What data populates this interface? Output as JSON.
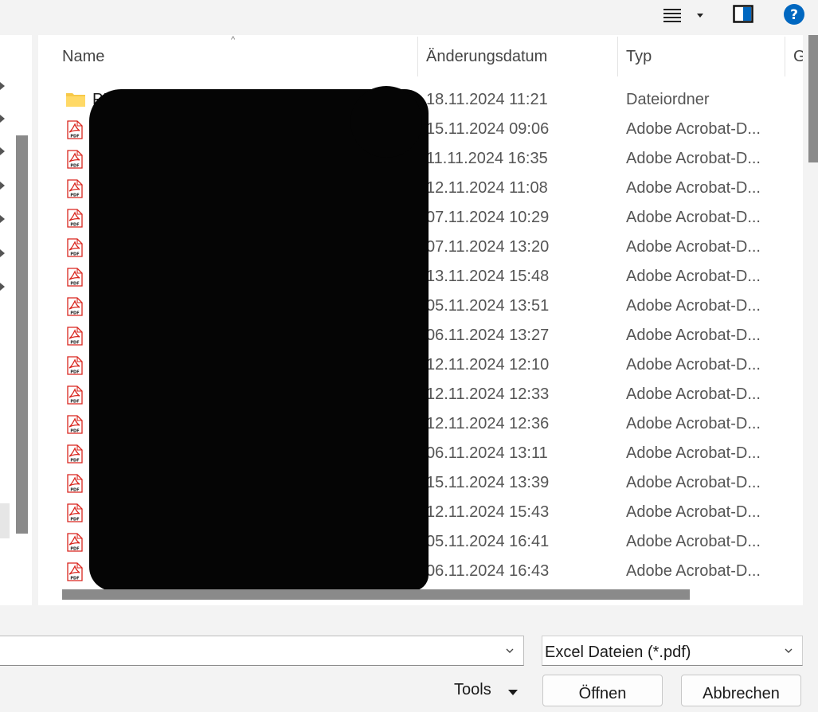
{
  "toolbar": {
    "view_icon": "list-view-icon",
    "dropdown_icon": "chevron-down-icon",
    "pane_icon": "preview-pane-icon",
    "help_icon": "help-icon",
    "help_label": "?",
    "help_color": "#0067c0"
  },
  "columns": {
    "name": "Name",
    "date": "Änderungsdatum",
    "type": "Typ",
    "size": "G"
  },
  "rows": [
    {
      "icon": "folder-icon",
      "name": "PDF",
      "date": "18.11.2024 11:21",
      "type": "Dateiordner"
    },
    {
      "icon": "pdf-icon",
      "name": "",
      "date": "15.11.2024 09:06",
      "type": "Adobe Acrobat-D..."
    },
    {
      "icon": "pdf-icon",
      "name": "",
      "date": "11.11.2024 16:35",
      "type": "Adobe Acrobat-D..."
    },
    {
      "icon": "pdf-icon",
      "name": "",
      "date": "12.11.2024 11:08",
      "type": "Adobe Acrobat-D..."
    },
    {
      "icon": "pdf-icon",
      "name": "",
      "date": "07.11.2024 10:29",
      "type": "Adobe Acrobat-D..."
    },
    {
      "icon": "pdf-icon",
      "name": "",
      "date": "07.11.2024 13:20",
      "type": "Adobe Acrobat-D..."
    },
    {
      "icon": "pdf-icon",
      "name": "",
      "date": "13.11.2024 15:48",
      "type": "Adobe Acrobat-D..."
    },
    {
      "icon": "pdf-icon",
      "name": "",
      "date": "05.11.2024 13:51",
      "type": "Adobe Acrobat-D..."
    },
    {
      "icon": "pdf-icon",
      "name": "",
      "date": "06.11.2024 13:27",
      "type": "Adobe Acrobat-D..."
    },
    {
      "icon": "pdf-icon",
      "name": "",
      "date": "12.11.2024 12:10",
      "type": "Adobe Acrobat-D..."
    },
    {
      "icon": "pdf-icon",
      "name": "",
      "date": "12.11.2024 12:33",
      "type": "Adobe Acrobat-D..."
    },
    {
      "icon": "pdf-icon",
      "name": "",
      "date": "12.11.2024 12:36",
      "type": "Adobe Acrobat-D..."
    },
    {
      "icon": "pdf-icon",
      "name": "",
      "date": "06.11.2024 13:11",
      "type": "Adobe Acrobat-D..."
    },
    {
      "icon": "pdf-icon",
      "name": "",
      "date": "15.11.2024 13:39",
      "type": "Adobe Acrobat-D..."
    },
    {
      "icon": "pdf-icon",
      "name": "",
      "date": "12.11.2024 15:43",
      "type": "Adobe Acrobat-D..."
    },
    {
      "icon": "pdf-icon",
      "name": "",
      "date": "05.11.2024 16:41",
      "type": "Adobe Acrobat-D..."
    },
    {
      "icon": "pdf-icon",
      "name": "",
      "date": "06.11.2024 16:43",
      "type": "Adobe Acrobat-D..."
    }
  ],
  "footer": {
    "filename_value": "",
    "filter_label": "Excel Dateien (*.pdf)",
    "tools_label": "Tools",
    "open_label": "Öffnen",
    "cancel_label": "Abbrechen"
  },
  "colors": {
    "pdf_red": "#d9251d",
    "folder_yellow": "#f7c948",
    "scrollbar": "#8a8a8a"
  }
}
